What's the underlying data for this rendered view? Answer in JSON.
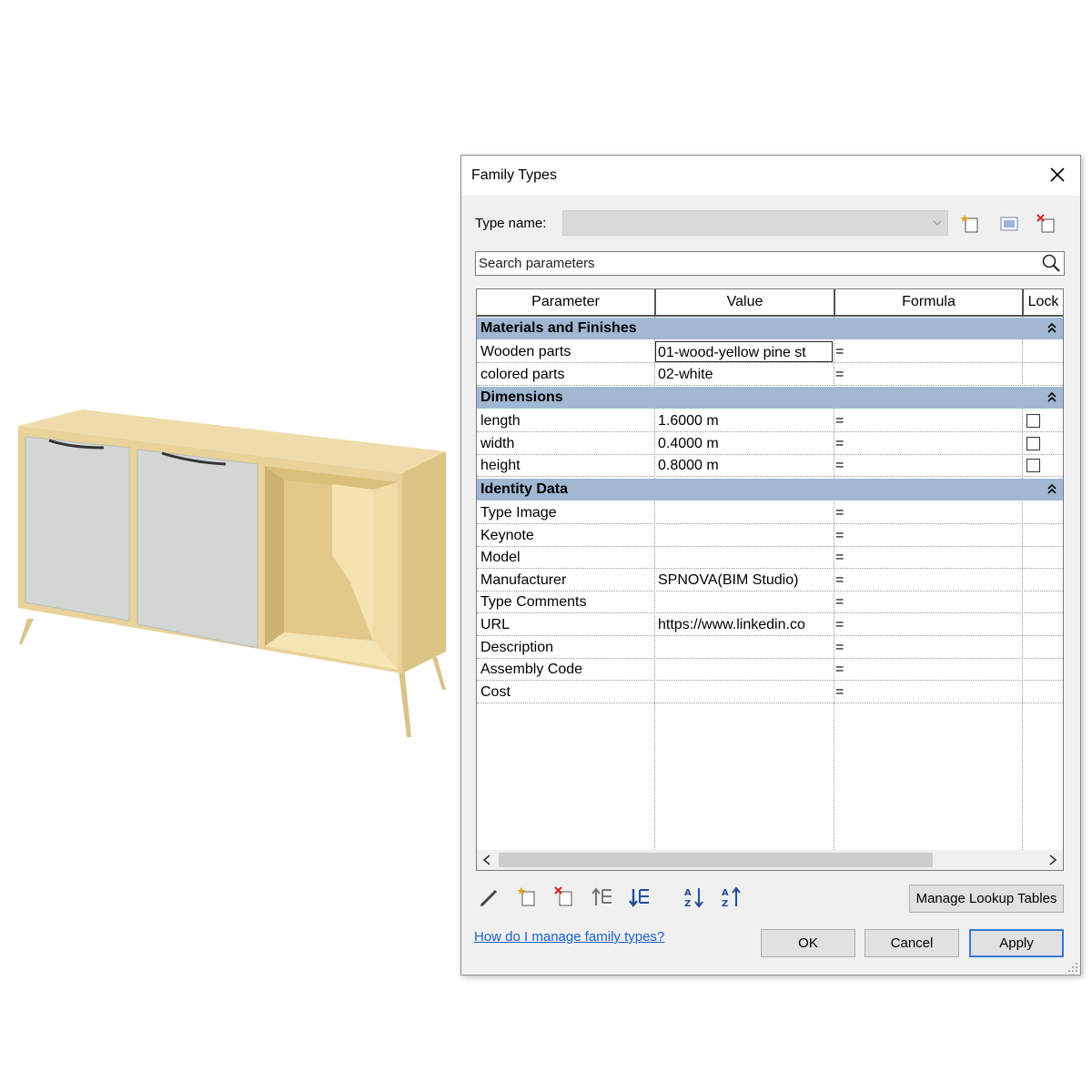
{
  "dialog": {
    "title": "Family Types",
    "type_name_label": "Type name:",
    "type_name_value": "",
    "search_placeholder": "Search parameters",
    "columns": [
      "Parameter",
      "Value",
      "Formula",
      "Lock"
    ],
    "sections": [
      {
        "name": "Materials and Finishes",
        "rows": [
          {
            "parameter": "Wooden parts",
            "value": "01-wood-yellow pine st",
            "formula": "=",
            "lock": null,
            "editing": true
          },
          {
            "parameter": "colored parts",
            "value": "02-white",
            "formula": "=",
            "lock": null
          }
        ]
      },
      {
        "name": "Dimensions",
        "rows": [
          {
            "parameter": "length",
            "value": "1.6000 m",
            "formula": "=",
            "lock": false
          },
          {
            "parameter": "width",
            "value": "0.4000 m",
            "formula": "=",
            "lock": false
          },
          {
            "parameter": "height",
            "value": "0.8000 m",
            "formula": "=",
            "lock": false
          }
        ]
      },
      {
        "name": "Identity Data",
        "rows": [
          {
            "parameter": "Type Image",
            "value": "",
            "formula": "=",
            "lock": null
          },
          {
            "parameter": "Keynote",
            "value": "",
            "formula": "=",
            "lock": null
          },
          {
            "parameter": "Model",
            "value": "",
            "formula": "=",
            "lock": null
          },
          {
            "parameter": "Manufacturer",
            "value": "SPNOVA(BIM Studio)",
            "formula": "=",
            "lock": null
          },
          {
            "parameter": "Type Comments",
            "value": "",
            "formula": "=",
            "lock": null
          },
          {
            "parameter": "URL",
            "value": "https://www.linkedin.co",
            "formula": "=",
            "lock": null
          },
          {
            "parameter": "Description",
            "value": "",
            "formula": "=",
            "lock": null
          },
          {
            "parameter": "Assembly Code",
            "value": "",
            "formula": "=",
            "lock": null
          },
          {
            "parameter": "Cost",
            "value": "",
            "formula": "=",
            "lock": null
          }
        ]
      }
    ],
    "toolbar_icons": [
      "edit-parameter-icon",
      "new-parameter-icon",
      "delete-parameter-icon",
      "move-up-icon",
      "move-down-icon",
      "sort-ascending-icon",
      "sort-descending-icon"
    ],
    "manage_lookup_label": "Manage Lookup Tables",
    "help_link": "How do I manage family types?",
    "ok_label": "OK",
    "cancel_label": "Cancel",
    "apply_label": "Apply"
  },
  "colors": {
    "section_header": "#a1b8d3",
    "link": "#1a5fd2",
    "apply_border": "#3a79d7",
    "cabinet_wood": "#e8d29a",
    "cabinet_door": "#d3d7d4"
  }
}
